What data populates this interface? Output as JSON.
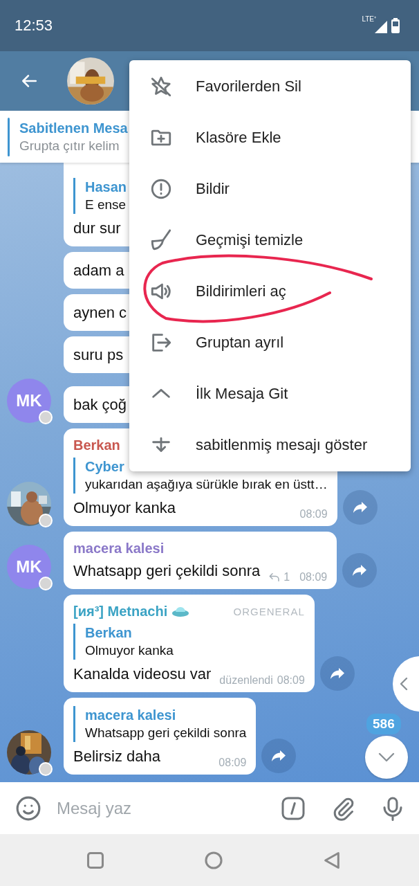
{
  "status_bar": {
    "time": "12:53",
    "network": "LTE⁺"
  },
  "pinned": {
    "title": "Sabitlenen Mesa",
    "text": "Grupta çıtır kelim"
  },
  "messages": [
    {
      "avatar": {
        "kind": "none"
      },
      "reply": {
        "name": "Hasan",
        "text": "E ense"
      },
      "text": "dur sur",
      "forward": false
    },
    {
      "avatar": {
        "kind": "none"
      },
      "text": "adam a",
      "forward": false
    },
    {
      "avatar": {
        "kind": "none"
      },
      "text": "aynen c",
      "forward": false
    },
    {
      "avatar": {
        "kind": "none"
      },
      "text": "suru ps",
      "forward": false
    },
    {
      "avatar": {
        "kind": "initials",
        "text": "MK",
        "color": "#8f86ec"
      },
      "text": "bak çoğ",
      "forward": false
    },
    {
      "sender": {
        "name": "Berkan",
        "color": "#c8574f"
      },
      "reply": {
        "name": "Cyber",
        "text": "yukarıdan aşağıya sürükle bırak en üstt…"
      },
      "text": "Olmuyor kanka",
      "time": "08:09",
      "forward": true
    },
    {
      "avatar": {
        "kind": "initials",
        "text": "MK",
        "color": "#8f86ec"
      },
      "sender": {
        "name": "macera kalesi",
        "color": "#8a78c8"
      },
      "text": "Whatsapp geri çekildi sonra",
      "replies": "1",
      "time": "08:09",
      "forward": true
    },
    {
      "avatar": {
        "kind": "none"
      },
      "sender": {
        "name": "[ия³] Metnachi",
        "color": "#3ba3c4"
      },
      "tag": "ORGENERAL",
      "reply": {
        "name": "Berkan",
        "text": "Olmuyor kanka"
      },
      "text": "Kanalda videosu var",
      "edited": "düzenlendi",
      "time": "08:09",
      "forward": true
    },
    {
      "reply": {
        "name": "macera kalesi",
        "text": "Whatsapp geri çekildi sonra"
      },
      "text": "Belirsiz daha",
      "time": "08:09",
      "forward": true
    }
  ],
  "scroll_down": {
    "badge": "586"
  },
  "menu": [
    {
      "kind": "unfavorite",
      "label": "Favorilerden Sil",
      "annotated": false
    },
    {
      "kind": "folder_add",
      "label": "Klasöre Ekle",
      "annotated": false
    },
    {
      "kind": "report",
      "label": "Bildir",
      "annotated": false
    },
    {
      "kind": "clear",
      "label": "Geçmişi temizle",
      "annotated": false
    },
    {
      "kind": "unmute",
      "label": "Bildirimleri aç",
      "annotated": true
    },
    {
      "kind": "leave",
      "label": "Gruptan ayrıl",
      "annotated": false
    },
    {
      "kind": "up",
      "label": "İlk Mesaja Git",
      "annotated": false
    },
    {
      "kind": "pinned",
      "label": "sabitlenmiş mesajı göster",
      "annotated": false
    }
  ],
  "composer": {
    "placeholder": "Mesaj yaz"
  }
}
